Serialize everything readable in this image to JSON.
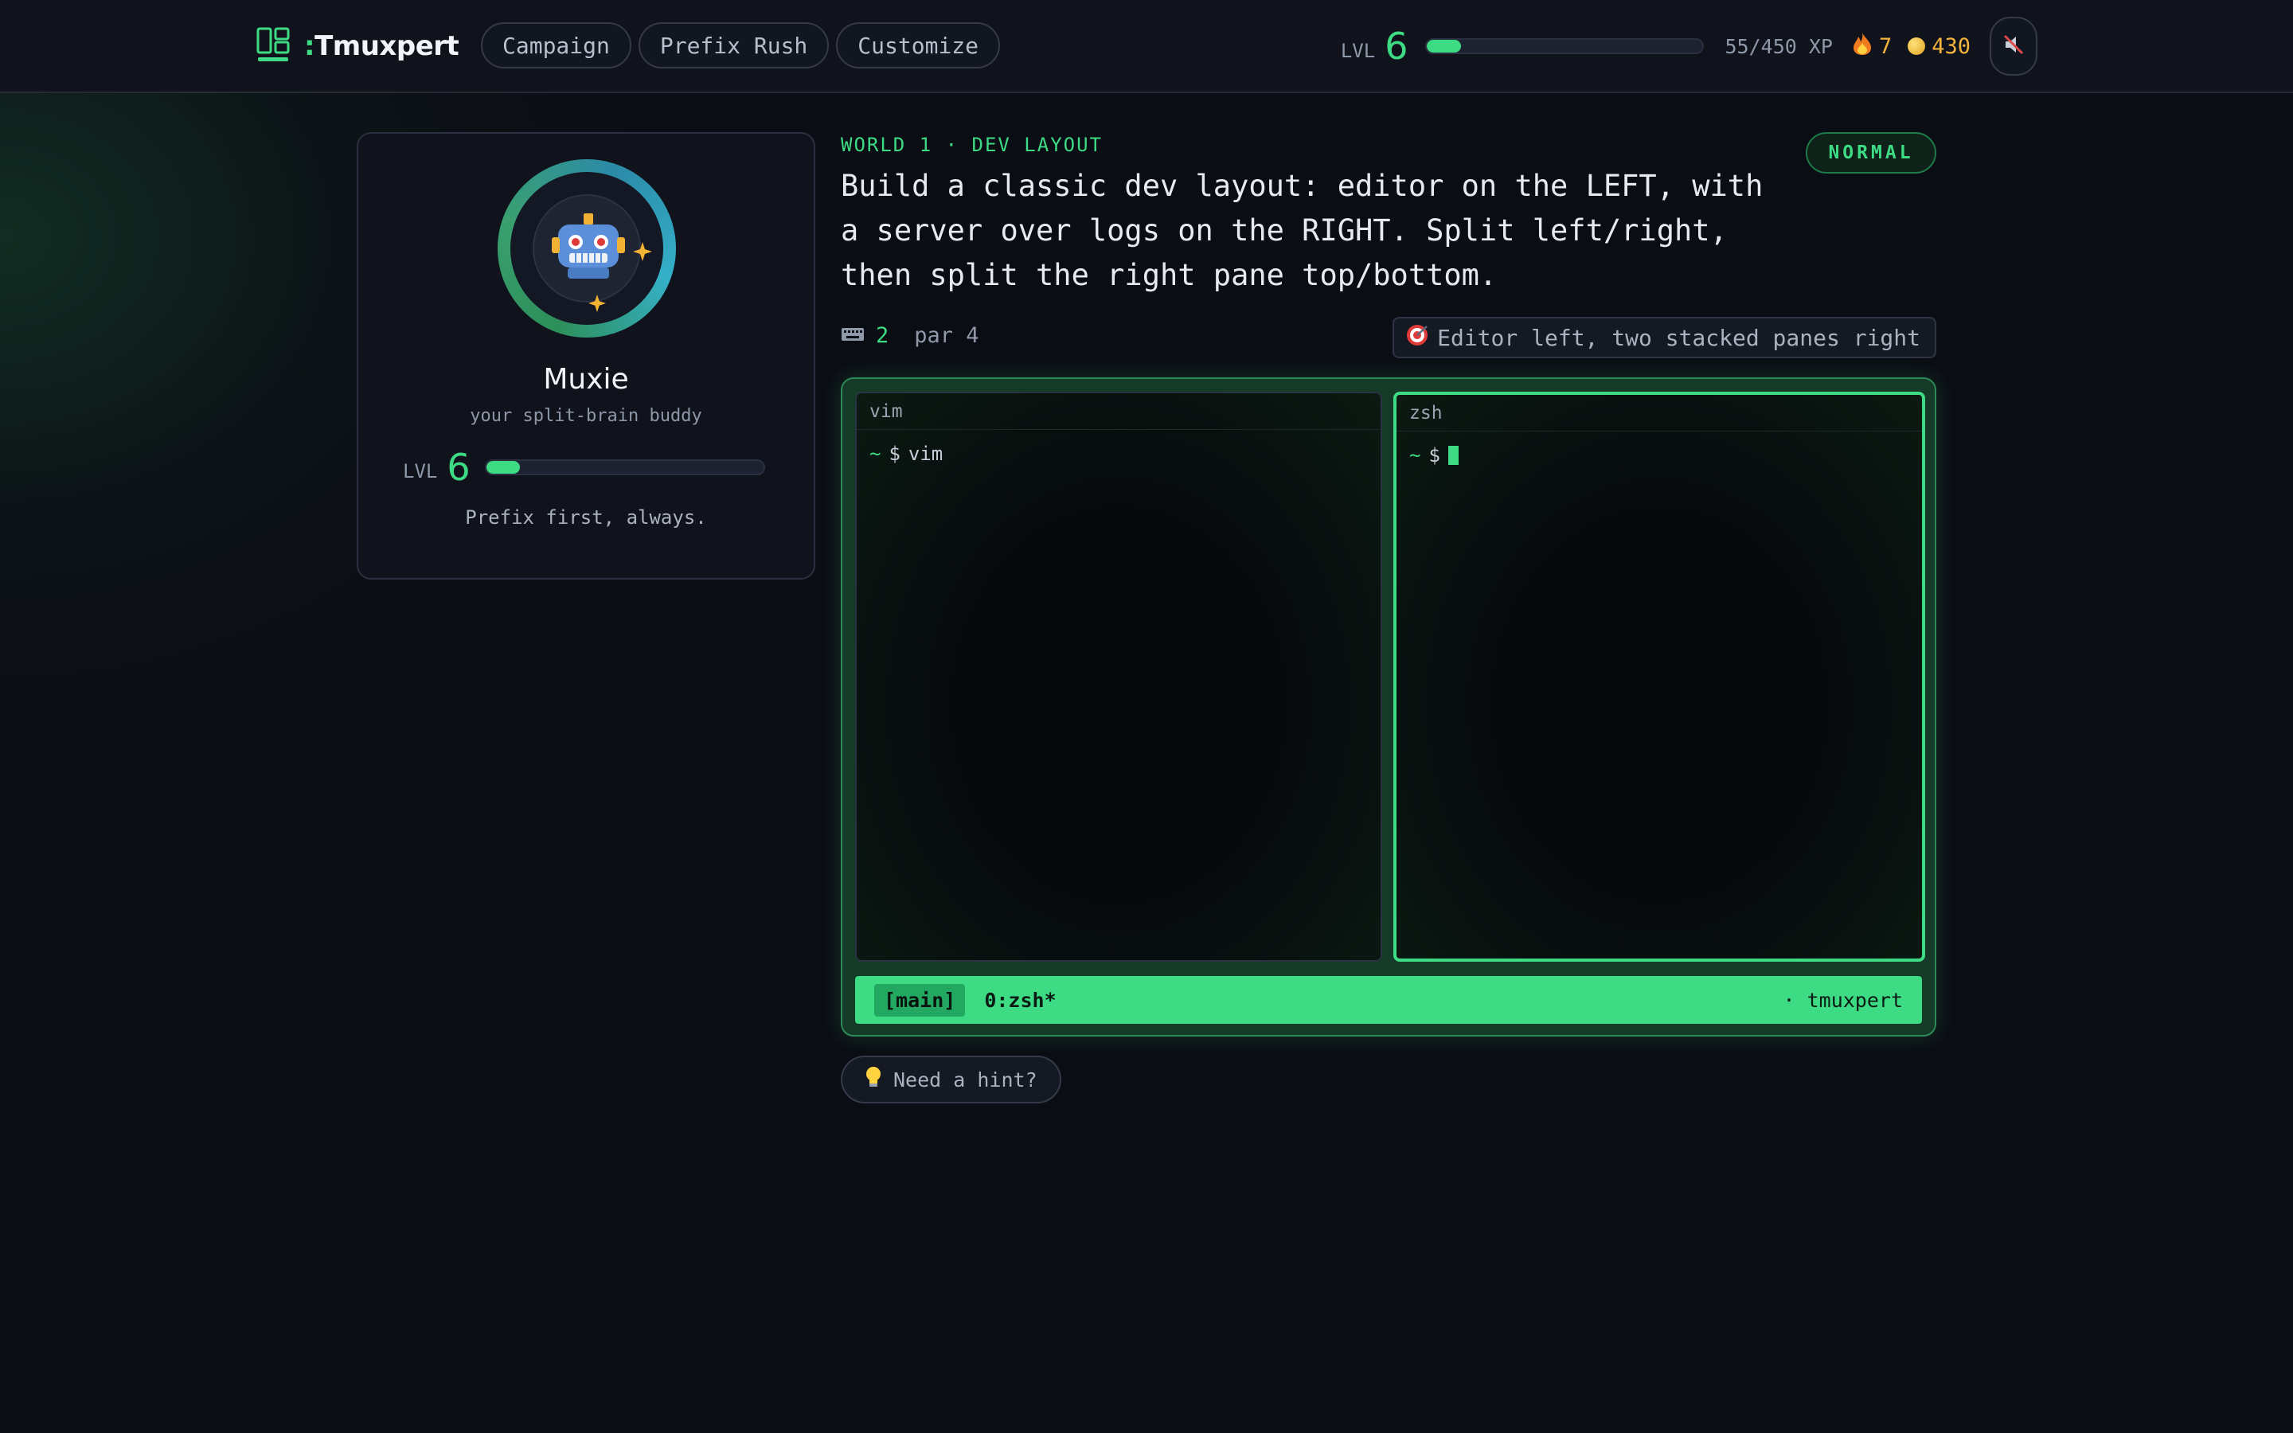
{
  "app": {
    "name": "Tmuxpert",
    "name_prefix": ":",
    "accent": "#3ddc84",
    "background": "#0b0d14"
  },
  "nav": {
    "items": [
      {
        "label": "Campaign"
      },
      {
        "label": "Prefix Rush"
      },
      {
        "label": "Customize"
      }
    ]
  },
  "hud": {
    "level_label": "LVL",
    "level": "6",
    "xp_text": "55/450 XP",
    "xp_fraction": 0.122,
    "streak": "7",
    "coins": "430",
    "sound_icon": "speaker-muted-icon"
  },
  "buddy": {
    "name": "Muxie",
    "subtitle": "your split-brain buddy",
    "level_label": "LVL",
    "level": "6",
    "xp_fraction": 0.122,
    "motto": "Prefix first, always.",
    "avatar_icon": "robot-icon"
  },
  "mission": {
    "world": "WORLD 1 · DEV LAYOUT",
    "mode": "NORMAL",
    "description": "Build a classic dev layout: editor on the LEFT, with a server over logs on the RIGHT. Split left/right, then split the right pane top/bottom.",
    "keystrokes": "2",
    "par": "par 4",
    "goal": "Editor left, two stacked panes right"
  },
  "terminal": {
    "panes": [
      {
        "title": "vim",
        "prompt": "~",
        "symbol": "$",
        "command": "vim"
      },
      {
        "title": "zsh",
        "prompt": "~",
        "symbol": "$",
        "command": ""
      }
    ],
    "status": {
      "session": "[main]",
      "window": "0:zsh*",
      "right": "· tmuxpert"
    }
  },
  "hint": {
    "label": "Need a hint?"
  }
}
